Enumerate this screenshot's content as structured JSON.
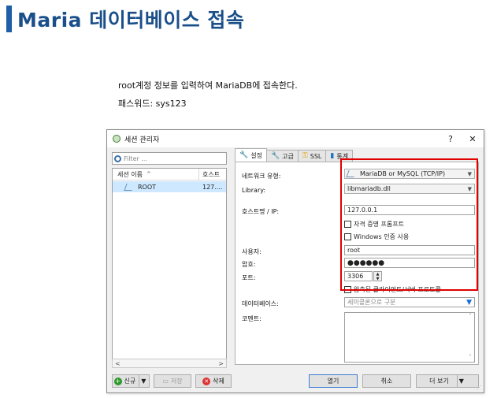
{
  "heading": {
    "title": "Maria 데이터베이스 접속"
  },
  "description": {
    "line1": "root계정 정보를 입력하여 MariaDB에 접속한다.",
    "line2": "패스워드: sys123"
  },
  "window": {
    "title": "세션 관리자",
    "help_label": "?",
    "close_label": "✕"
  },
  "session_list": {
    "filter_placeholder": "Filter ...",
    "column_name": "세션 이름",
    "column_host": "호스트",
    "sort_indicator": "^",
    "rows": [
      {
        "name": "ROOT",
        "host": "127...."
      }
    ],
    "scroll_left": "<",
    "scroll_right": ">"
  },
  "tabs": [
    {
      "label": "설정",
      "icon": "wrench-icon"
    },
    {
      "label": "고급",
      "icon": "wrench-icon"
    },
    {
      "label": "SSL",
      "icon": "key-icon"
    },
    {
      "label": "통계",
      "icon": "bar-chart-icon"
    }
  ],
  "settings": {
    "network_type_label": "네트워크 유형:",
    "network_type_value": "MariaDB or MySQL (TCP/IP)",
    "library_label": "Library:",
    "library_value": "libmariadb.dll",
    "host_label": "호스트명 / IP:",
    "host_value": "127.0.0.1",
    "prompt_credentials": "자격 증명 프롬프트",
    "windows_auth": "Windows 인증 사용",
    "user_label": "사용자:",
    "user_value": "root",
    "password_label": "암호:",
    "password_value": "●●●●●●",
    "port_label": "포트:",
    "port_value": "3306",
    "compressed_protocol": "압축된 클라이언트/서버 프로토콜",
    "database_label": "데이터베이스:",
    "database_placeholder": "세미콜론으로 구분",
    "comment_label": "코멘트:"
  },
  "buttons": {
    "new": "신규",
    "save": "저장",
    "delete": "삭제",
    "open": "열기",
    "cancel": "취소",
    "more": "더 보기"
  },
  "colors": {
    "heading": "#1a4f8a",
    "highlight_box": "#e00000",
    "selected_row": "#cde8ff"
  }
}
